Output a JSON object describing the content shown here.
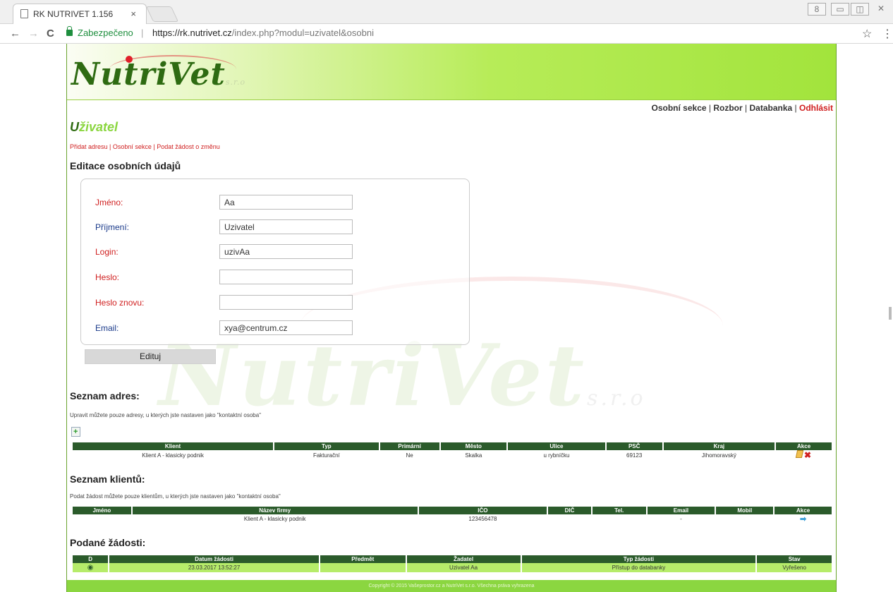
{
  "browser": {
    "tab_title": "RK NUTRIVET 1.156",
    "tab_close": "×",
    "secure_label": "Zabezpečeno",
    "url_host": "https://rk.nutrivet.cz",
    "url_rest": "/index.php?modul=uzivatel&osobni",
    "back": "←",
    "forward": "→",
    "reload": "C",
    "star": "☆",
    "menu": "⋮",
    "win_user": "8",
    "win_min": "▭",
    "win_max": "◫",
    "win_close": "✕"
  },
  "logo": {
    "text": "NutriVet",
    "sro": "s.r.o"
  },
  "topnav": {
    "osobni": "Osobní sekce",
    "rozbor": "Rozbor",
    "databanka": "Databanka",
    "odhlasit": "Odhlásit",
    "sep": " | "
  },
  "page": {
    "title_first": "U",
    "title_rest": "živatel",
    "sublinks": {
      "pridat": "Přidat adresu",
      "osobni": "Osobní sekce",
      "zadost": "Podat žádost o změnu",
      "sep": " | "
    },
    "edit_heading": "Editace osobních údajů"
  },
  "form": {
    "fields": [
      {
        "label": "Jméno:",
        "value": "Aa"
      },
      {
        "label": "Příjmení:",
        "value": "Uzivatel"
      },
      {
        "label": "Login:",
        "value": "uzivAa"
      },
      {
        "label": "Heslo:",
        "value": ""
      },
      {
        "label": "Heslo znovu:",
        "value": ""
      },
      {
        "label": "Email:",
        "value": "xya@centrum.cz"
      }
    ],
    "submit_label": "Edituj"
  },
  "addresses": {
    "heading": "Seznam adres:",
    "note": "Upravit můžete pouze adresy, u kterých jste nastaven jako \"kontaktní osoba\"",
    "columns": [
      "Klient",
      "Typ",
      "Primární",
      "Město",
      "Ulice",
      "PSČ",
      "Kraj",
      "Akce"
    ],
    "rows": [
      [
        "Klient A - klasicky podnik",
        "Fakturační",
        "Ne",
        "Skalka",
        "u rybníčku",
        "69123",
        "Jihomoravský"
      ]
    ]
  },
  "clients": {
    "heading": "Seznam klientů:",
    "note": "Podat žádost můžete pouze klientům, u kterých jste nastaven jako \"kontaktní osoba\"",
    "columns": [
      "Jméno",
      "Název firmy",
      "IČO",
      "DIČ",
      "Tel.",
      "Email",
      "Mobil",
      "Akce"
    ],
    "rows": [
      [
        "",
        "Klient A - klasicky podnik",
        "123456478",
        "",
        "",
        "-",
        ""
      ]
    ]
  },
  "requests": {
    "heading": "Podané žádosti:",
    "columns": [
      "D",
      "Datum žádosti",
      "Předmět",
      "Žadatel",
      "Typ žádosti",
      "Stav"
    ],
    "rows": [
      [
        "",
        "23.03.2017 13:52:27",
        "",
        "Uzivatel Aa",
        "Přístup do databanky",
        "Vyřešeno"
      ]
    ]
  },
  "footer": {
    "text": "Copyright © 2015 Vašeprostor.cz a NutriVet s.r.o. Všechna práva vyhrazena"
  },
  "colors": {
    "dark_green": "#2b5b2b",
    "light_green": "#8bd640",
    "red": "#d02020"
  }
}
